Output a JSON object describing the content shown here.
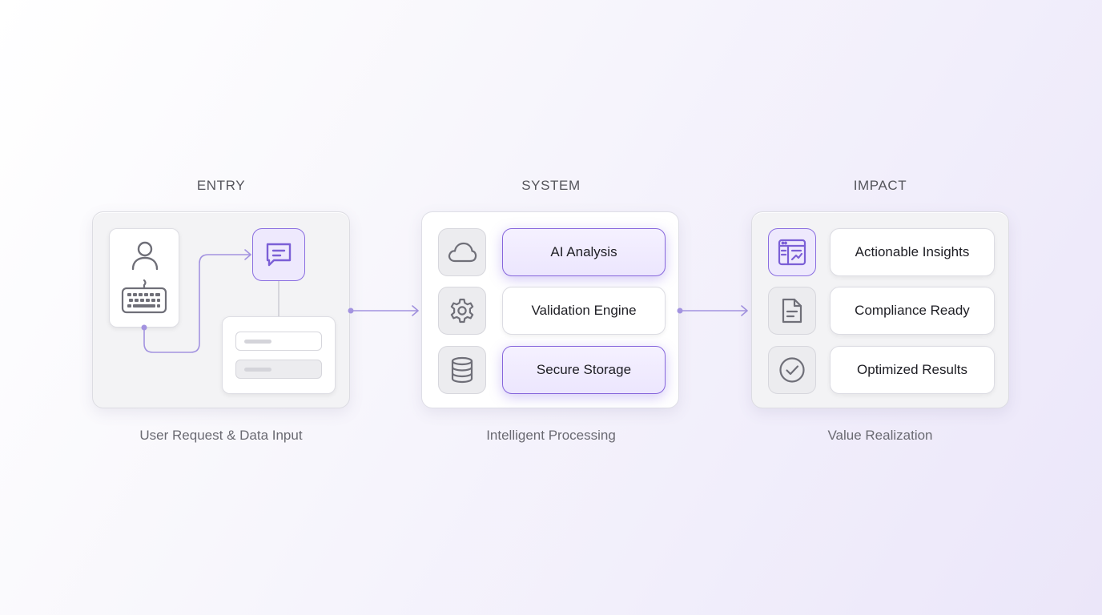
{
  "stages": {
    "entry": {
      "title": "ENTRY",
      "caption": "User Request & Data Input",
      "icons": [
        "user-icon",
        "keyboard-icon",
        "chat-icon"
      ]
    },
    "system": {
      "title": "SYSTEM",
      "caption": "Intelligent Processing",
      "items": [
        {
          "icon": "cloud-icon",
          "label": "AI Analysis",
          "highlighted": true
        },
        {
          "icon": "gear-icon",
          "label": "Validation Engine",
          "highlighted": false
        },
        {
          "icon": "database-icon",
          "label": "Secure Storage",
          "highlighted": true
        }
      ]
    },
    "impact": {
      "title": "IMPACT",
      "caption": "Value Realization",
      "items": [
        {
          "icon": "dashboard-icon",
          "label": "Actionable Insights",
          "highlighted": true
        },
        {
          "icon": "document-icon",
          "label": "Compliance Ready",
          "highlighted": false
        },
        {
          "icon": "check-circle-icon",
          "label": "Optimized Results",
          "highlighted": false
        }
      ]
    }
  },
  "colors": {
    "accent": "#8a6ee0",
    "accent_light": "#eee9fd",
    "connector": "#a393e0",
    "icon_grey": "#6f6f78",
    "text": "#1e1e24",
    "muted_text": "#6a6a72"
  }
}
